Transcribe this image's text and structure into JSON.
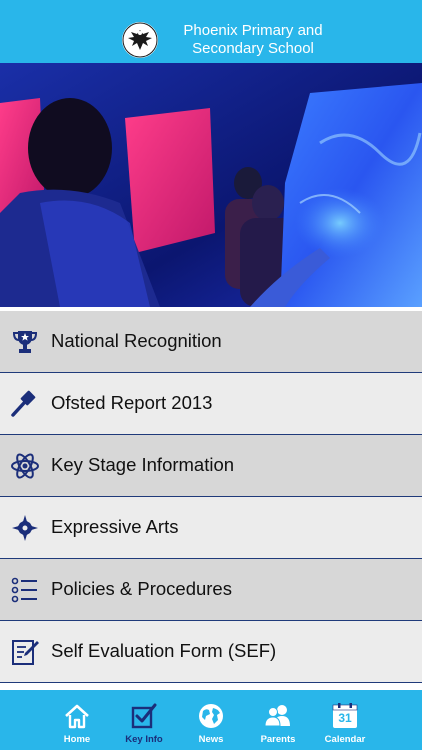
{
  "header": {
    "title_line1": "Phoenix Primary and",
    "title_line2": "Secondary School"
  },
  "menu": {
    "items": [
      {
        "label": "National Recognition",
        "icon": "trophy-icon"
      },
      {
        "label": "Ofsted Report 2013",
        "icon": "gavel-icon"
      },
      {
        "label": "Key Stage Information",
        "icon": "atom-icon"
      },
      {
        "label": "Expressive Arts",
        "icon": "compass-star-icon"
      },
      {
        "label": "Policies & Procedures",
        "icon": "list-icon"
      },
      {
        "label": "Self Evaluation Form (SEF)",
        "icon": "edit-form-icon"
      }
    ]
  },
  "tabbar": {
    "tabs": [
      {
        "label": "Home",
        "icon": "home-icon"
      },
      {
        "label": "Key Info",
        "icon": "checkbox-icon",
        "active": true
      },
      {
        "label": "News",
        "icon": "globe-icon"
      },
      {
        "label": "Parents",
        "icon": "people-icon"
      },
      {
        "label": "Calendar",
        "icon": "calendar-icon",
        "day": "31"
      }
    ]
  },
  "colors": {
    "header": "#29b6ea",
    "icon_navy": "#1b2e7a",
    "row_dark": "#d7d7d7",
    "row_light": "#ececec"
  }
}
